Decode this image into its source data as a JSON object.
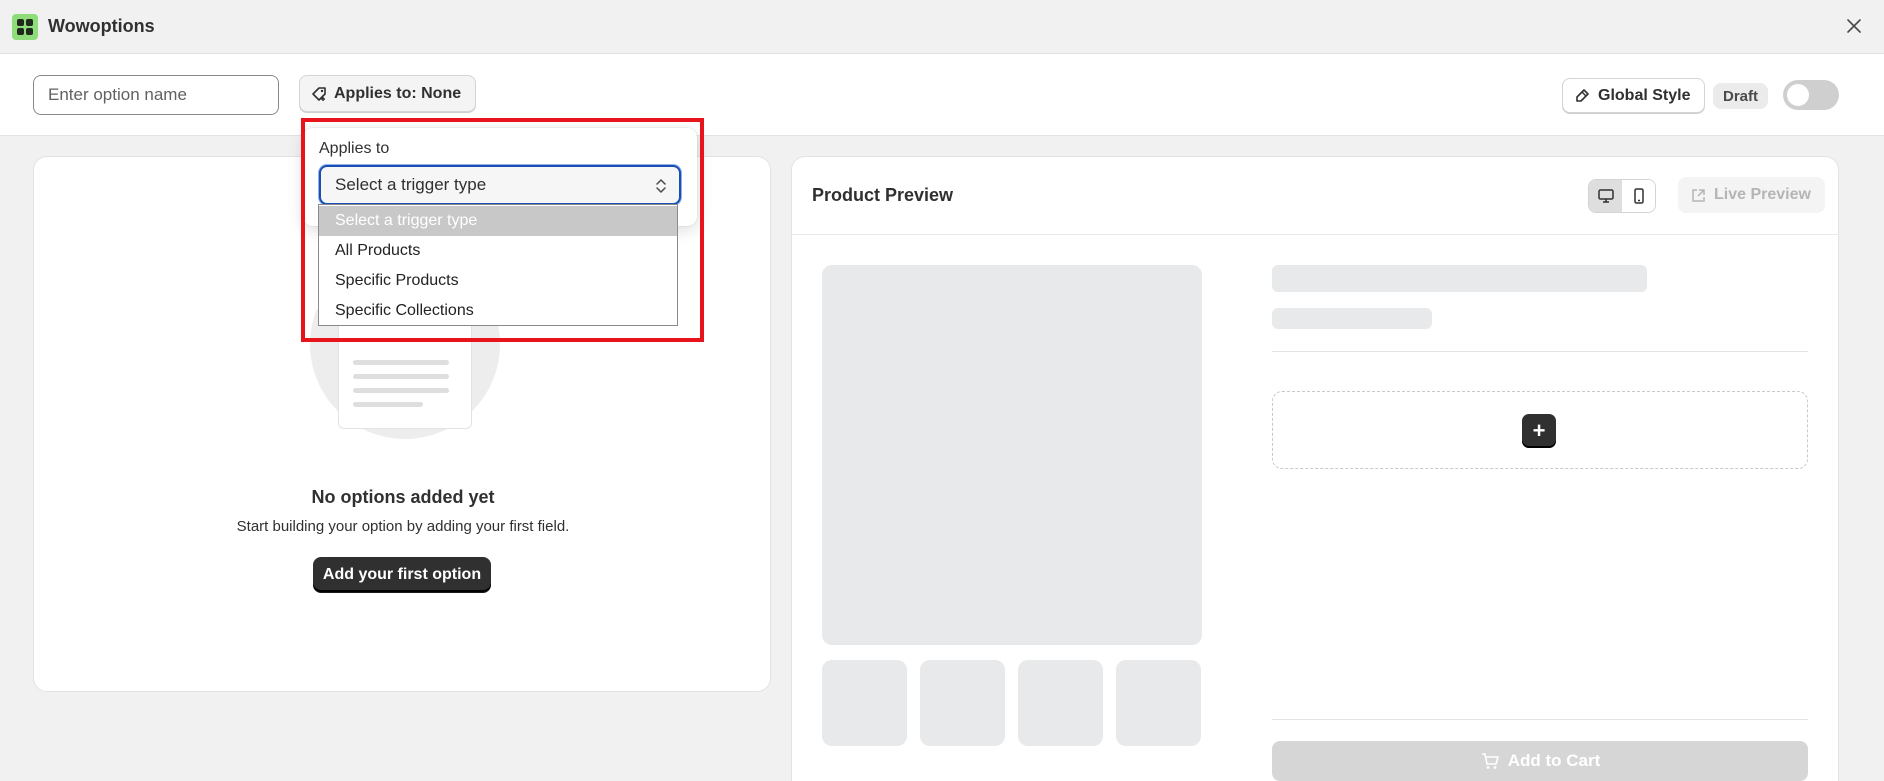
{
  "app": {
    "title": "Wowoptions"
  },
  "toolbar": {
    "option_name_placeholder": "Enter option name",
    "option_name_value": "",
    "applies_to_label": "Applies to: None",
    "global_style_label": "Global Style",
    "status_badge": "Draft",
    "publish_toggle_on": false
  },
  "applies_popover": {
    "label": "Applies to",
    "selected": "Select a trigger type",
    "options": [
      "Select a trigger type",
      "All Products",
      "Specific Products",
      "Specific Collections"
    ]
  },
  "options_panel": {
    "empty_title": "No options added yet",
    "empty_subtitle": "Start building your option by adding your first field.",
    "add_first_label": "Add your first option"
  },
  "preview": {
    "title": "Product Preview",
    "live_preview_label": "Live Preview",
    "device_selected": "desktop",
    "add_to_cart_label": "Add to Cart",
    "add_field_glyph": "+"
  },
  "colors": {
    "primary_button": "#303030",
    "focus_ring": "#1a50b4",
    "annotation_frame": "#e8141b",
    "logo_bg": "#8fdc7a"
  },
  "icons": {
    "close": "close-icon",
    "applies_to": "tag-icon",
    "global_style": "brush-icon",
    "desktop": "desktop-icon",
    "mobile": "mobile-icon",
    "live_preview": "external-link-icon",
    "cart": "cart-icon"
  }
}
